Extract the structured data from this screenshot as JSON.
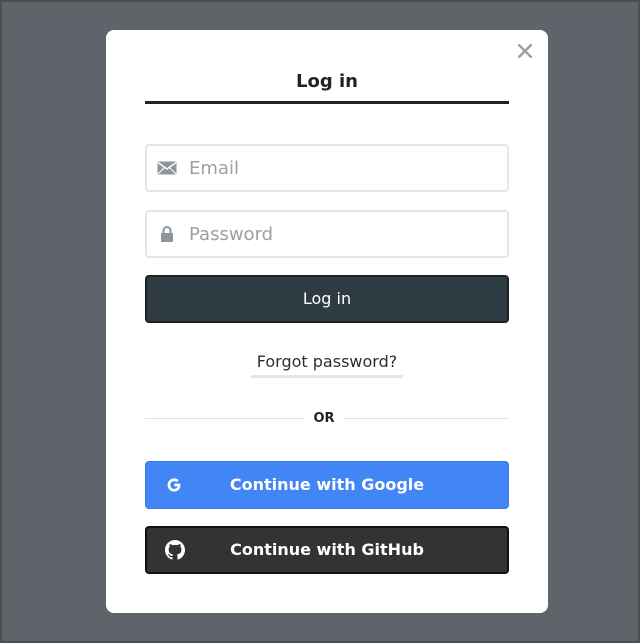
{
  "modal": {
    "title": "Log in",
    "close_icon": "close-icon"
  },
  "email": {
    "placeholder": "Email",
    "value": "",
    "icon": "envelope-icon"
  },
  "password": {
    "placeholder": "Password",
    "value": "",
    "icon": "lock-icon"
  },
  "login_button": {
    "label": "Log in"
  },
  "forgot_password": {
    "label": "Forgot password?"
  },
  "divider": {
    "label": "OR"
  },
  "google_button": {
    "label": "Continue with Google",
    "icon": "google-icon",
    "color": "#4285f4"
  },
  "github_button": {
    "label": "Continue with GitHub",
    "icon": "github-icon",
    "color": "#333333"
  },
  "colors": {
    "backdrop": "#5e6469",
    "primary_dark": "#2f3b42"
  }
}
